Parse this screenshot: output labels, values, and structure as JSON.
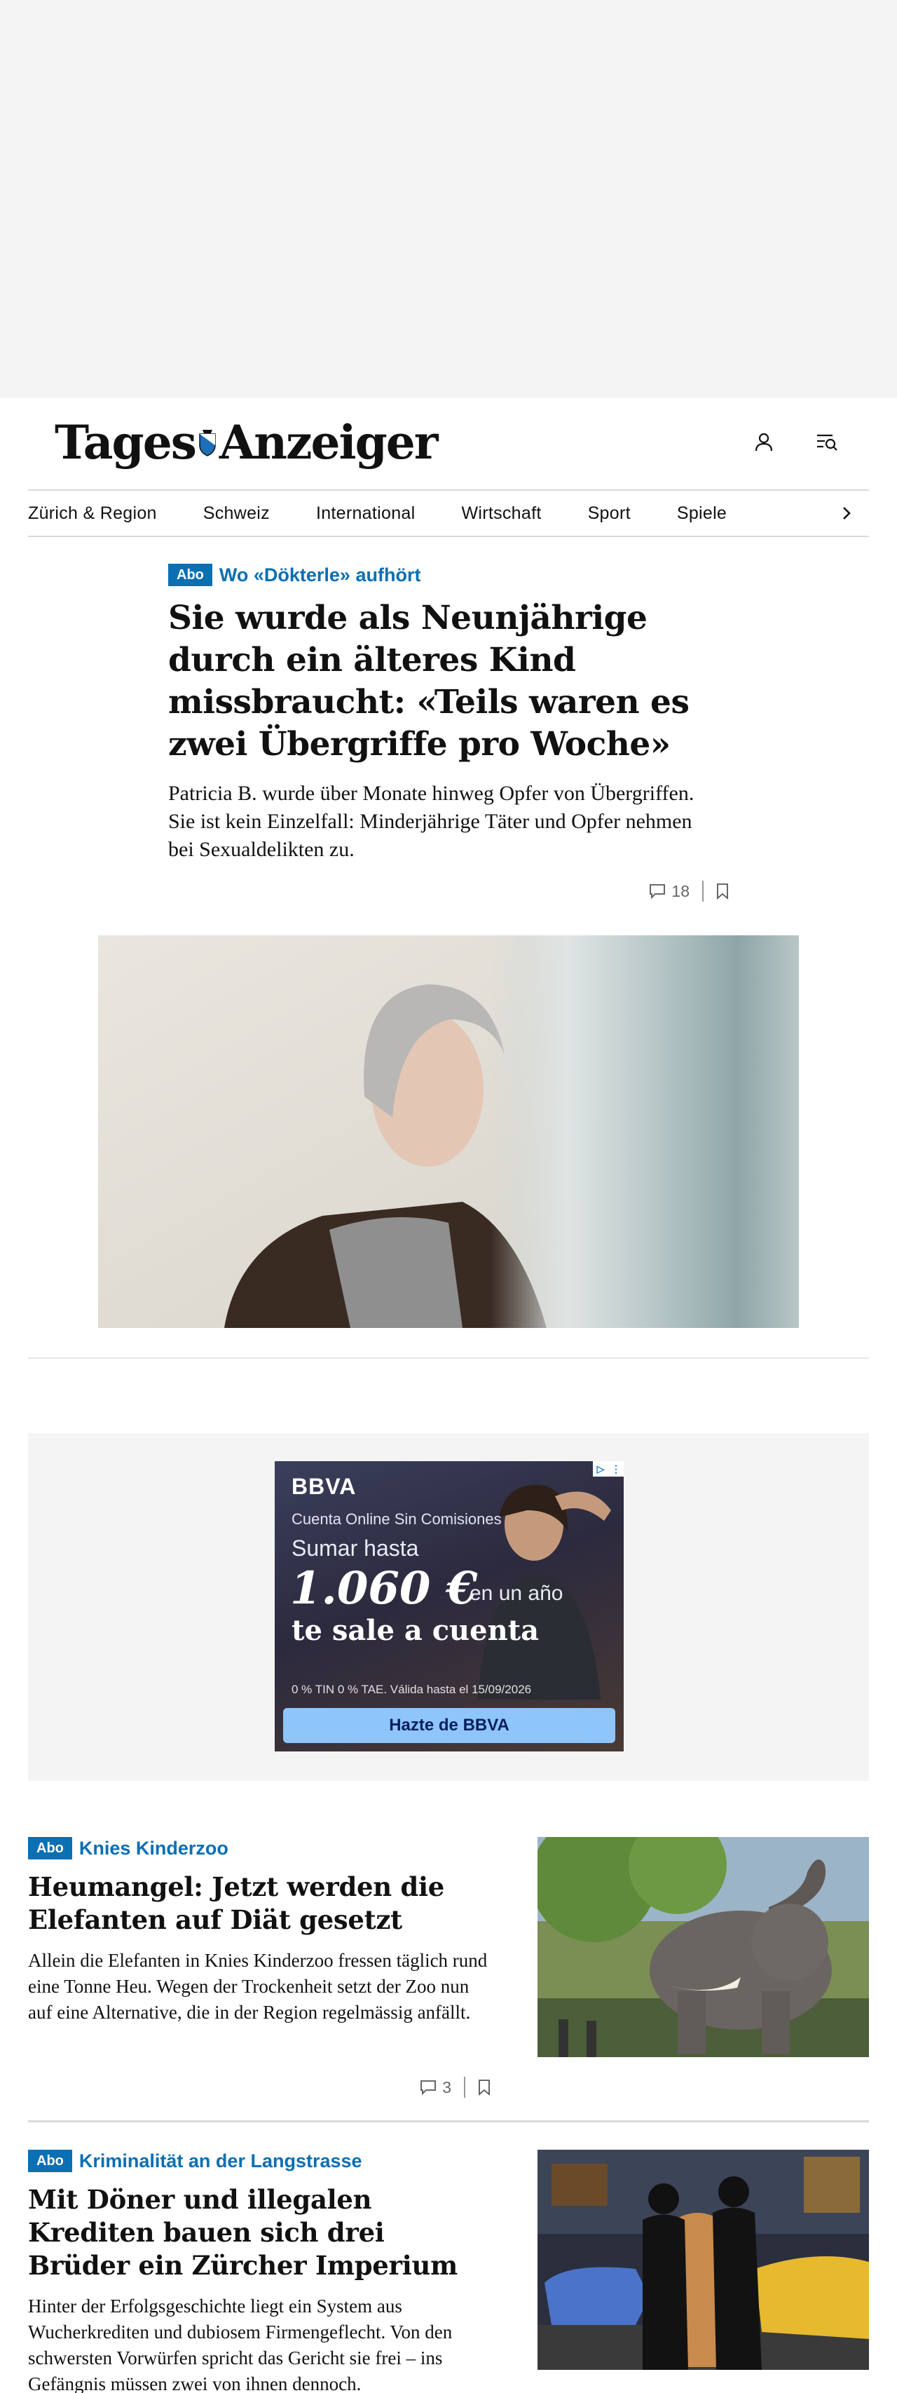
{
  "header": {
    "logo_text": "Tages Anzeiger",
    "user_icon": "user-icon",
    "menu_icon": "menu-search-icon"
  },
  "nav": {
    "items": [
      "Zürich & Region",
      "Schweiz",
      "International",
      "Wirtschaft",
      "Sport",
      "Spiele"
    ],
    "more_icon": "chevron-right-icon"
  },
  "lead_article": {
    "badge": "Abo",
    "kicker": "Wo «Dökterle» aufhört",
    "title": "Sie wurde als Neunjährige durch ein älteres Kind missbraucht: «Teils waren es zwei Übergriffe pro Woche»",
    "lead": "Patricia B. wurde über Monate hinweg Opfer von Übergriffen. Sie ist kein Einzelfall: Minderjährige Täter und Opfer nehmen bei Sexualdelikten zu.",
    "comments": "18"
  },
  "ad": {
    "brand": "BBVA",
    "line1": "Cuenta Online Sin Comisiones",
    "line2": "Sumar hasta",
    "amount": "1.060 €",
    "amount_suffix": "en un año",
    "line4": "te sale a cuenta",
    "fine_print": "0 % TIN 0 % TAE. Válida hasta el 15/09/2026",
    "cta": "Hazte de BBVA"
  },
  "teasers": [
    {
      "badge": "Abo",
      "kicker": "Knies Kinderzoo",
      "title": "Heumangel: Jetzt werden die Elefanten auf Diät gesetzt",
      "lead": "Allein die Elefanten in Knies Kinderzoo fressen täglich rund eine Tonne Heu. Wegen der Trockenheit setzt der Zoo nun auf eine Alternative, die in der Region regelmässig anfällt.",
      "comments": "3"
    },
    {
      "badge": "Abo",
      "kicker": "Kriminalität an der Langstrasse",
      "title": "Mit Döner und illegalen Krediten bauen sich drei Brüder ein Zürcher Imperium",
      "lead": "Hinter der Erfolgsgeschichte liegt ein System aus Wucherkrediten und dubiosem Firmengeflecht. Von den schwersten Vorwürfen spricht das Gericht sie frei – ins Gefängnis müssen zwei von ihnen dennoch."
    }
  ]
}
